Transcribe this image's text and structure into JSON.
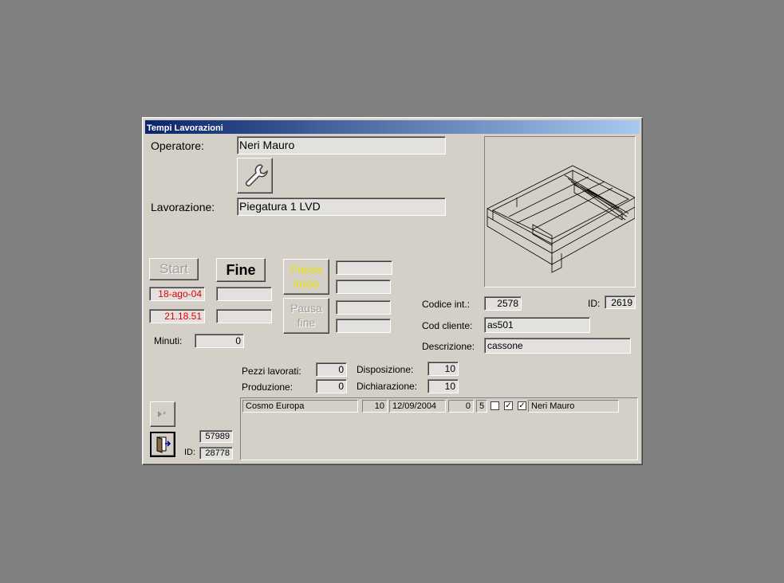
{
  "window": {
    "title": "Tempi Lavorazioni"
  },
  "operator": {
    "label": "Operatore:",
    "value": "Neri Mauro"
  },
  "work": {
    "label": "Lavorazione:",
    "value": "Piegatura 1 LVD"
  },
  "buttons": {
    "start": "Start",
    "fine": "Fine",
    "pausa_inizio": [
      "Pausa",
      "inizio"
    ],
    "pausa_fine": [
      "Pausa",
      "fine"
    ]
  },
  "start_date": "18-ago-04",
  "start_time": "21.18.51",
  "minutes": {
    "label": "Minuti:",
    "value": "0"
  },
  "product": {
    "codice_label": "Codice  int.:",
    "codice_value": "2578",
    "id_label": "ID:",
    "id_value": "2619",
    "cliente_label": "Cod cliente:",
    "cliente_value": "as501",
    "descr_label": "Descrizione:",
    "descr_value": "cassone"
  },
  "counts": {
    "pezzi_label": "Pezzi lavorati:",
    "pezzi_value": "0",
    "produzione_label": "Produzione:",
    "produzione_value": "0",
    "disposizione_label": "Disposizione:",
    "disposizione_value": "10",
    "dichiarazione_label": "Dichiarazione:",
    "dichiarazione_value": "10"
  },
  "record": {
    "number": "57989",
    "id_label": "ID:",
    "id_value": "28778"
  },
  "list": {
    "rows": [
      {
        "cliente": "Cosmo Europa",
        "qty": "10",
        "date": "12/09/2004",
        "n1": "0",
        "n2": "5",
        "check1": false,
        "check2": true,
        "check3": true,
        "operator": "Neri Mauro"
      }
    ]
  },
  "icons": {
    "tool": "wrench-icon",
    "new_record": "new-record-icon",
    "exit": "exit-door-icon"
  },
  "colors": {
    "title_start": "#0a246a",
    "title_end": "#a6caf0",
    "date_red": "#e00000",
    "pausa_yellow": "#f0e000"
  }
}
